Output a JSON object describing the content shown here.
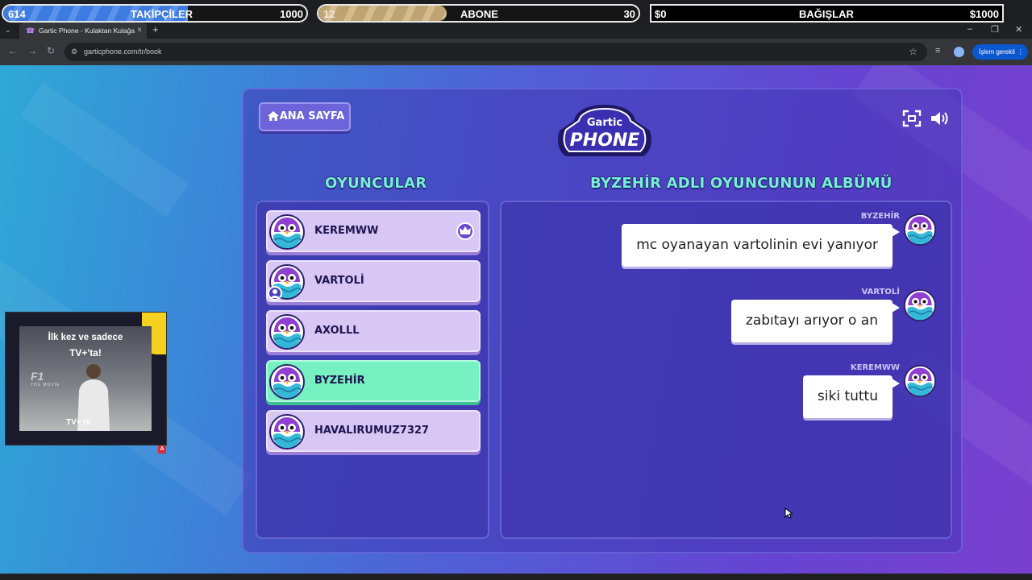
{
  "overlay": {
    "followers": {
      "current": "614",
      "label": "TAKİPÇİLER",
      "goal": "1000",
      "progress": 0.61
    },
    "subscribers": {
      "current": "12",
      "label": "ABONE",
      "goal": "30",
      "progress": 0.4
    },
    "donations": {
      "current": "$0",
      "label": "BAĞIŞLAR",
      "goal": "$1000",
      "progress": 0.0
    }
  },
  "browser": {
    "tab_title": "Gartic Phone - Kulaktan Kulağa",
    "url": "garticphone.com/tr/book",
    "action_label": "İşlem gerekli"
  },
  "game": {
    "home_label": "ANA SAYFA",
    "logo_small": "Gartic",
    "logo_big": "PHONE",
    "players_heading": "OYUNCULAR",
    "album_heading": "BYZEHİR ADLI OYUNCUNUN ALBÜMÜ",
    "players": [
      {
        "name": "KEREMWW",
        "state": "host"
      },
      {
        "name": "VARTOLİ",
        "state": "you"
      },
      {
        "name": "AXOLLL",
        "state": "normal"
      },
      {
        "name": "BYZEHİR",
        "state": "active"
      },
      {
        "name": "HAVALIRUMUZ7327",
        "state": "normal"
      }
    ],
    "messages": [
      {
        "author": "BYZEHİR",
        "text": "mc oyanayan vartolinin evi yanıyor"
      },
      {
        "author": "VARTOLİ",
        "text": "zabıtayı arıyor o an"
      },
      {
        "author": "KEREMWW",
        "text": "siki tuttu"
      }
    ]
  },
  "ad": {
    "line1": "İlk kez ve sadece",
    "line2": "TV+'ta!",
    "logo": "F1",
    "logo_sub": "THE MOVIE",
    "brand": "TV+ tv",
    "badge": "A"
  },
  "colors": {
    "accent": "#74f0d2",
    "active_player": "#77f0c2",
    "player": "#d8c7f4"
  }
}
